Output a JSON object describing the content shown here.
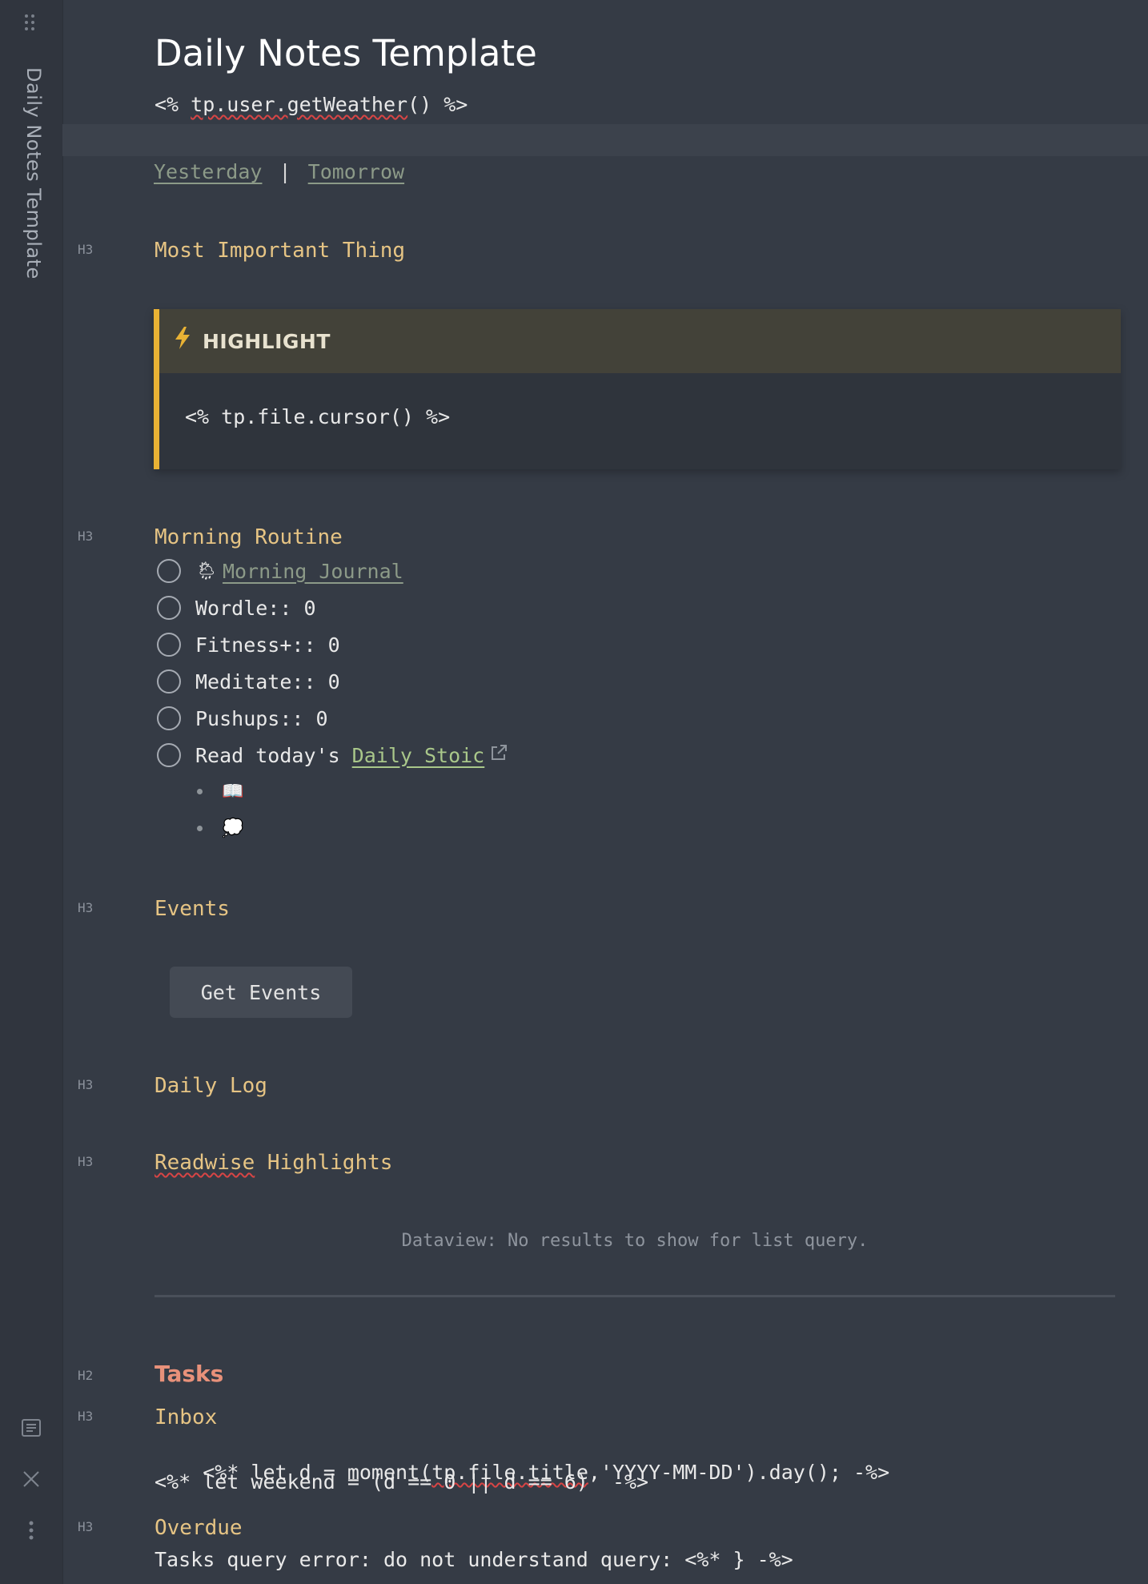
{
  "sidebar": {
    "handle_icon": "drag-handle-icon",
    "title": "Daily Notes Template",
    "bottom_icons": [
      "document-icon",
      "close-icon",
      "more-vertical-icon"
    ]
  },
  "note": {
    "title": "Daily Notes Template",
    "weather_prefix": "<% ",
    "weather_fn": "tp.user.getWeather",
    "weather_suffix": "() %>",
    "nav": {
      "yesterday": "Yesterday",
      "separator": "|",
      "tomorrow": "Tomorrow"
    },
    "heading_marker_h3": "H3",
    "heading_marker_h2": "H2",
    "most_important": {
      "heading": "Most Important Thing",
      "callout_label": "HIGHLIGHT",
      "callout_icon": "lightning-icon",
      "callout_body": "<% tp.file.cursor() %>"
    },
    "morning": {
      "heading": "Morning Routine",
      "tasks": [
        {
          "emoji": "🌦",
          "text": "Morning Journal",
          "is_link": true
        },
        {
          "text": "Wordle:: 0"
        },
        {
          "text": "Fitness+:: 0"
        },
        {
          "text": "Meditate:: 0"
        },
        {
          "text": "Pushups:: 0"
        },
        {
          "text": "Read today's ",
          "link": "Daily Stoic"
        }
      ],
      "subbullets": [
        "📖",
        "💭"
      ]
    },
    "events": {
      "heading": "Events",
      "button": "Get Events"
    },
    "daily_log": {
      "heading": "Daily Log"
    },
    "readwise": {
      "heading_a": "Readwise",
      "heading_b": " Highlights",
      "empty": "Dataview: No results to show for list query."
    },
    "tasks": {
      "heading": "Tasks",
      "inbox": "Inbox",
      "line1_a": "<%* let d = moment(",
      "line1_b": "tp.file.title",
      "line1_c": ",'YYYY-MM-DD').day(); -%>",
      "line2": "<%* let weekend = (d == 0 || d == 6)  -%>",
      "overdue": "Overdue",
      "error": "Tasks query error: do not understand query: <%* } -%>"
    }
  },
  "colors": {
    "background": "#353b45",
    "heading3": "#e6c484",
    "heading2": "#e8917a",
    "callout_accent": "#e9b234",
    "link": "#8c9a88",
    "external_link": "#a9c78a"
  }
}
